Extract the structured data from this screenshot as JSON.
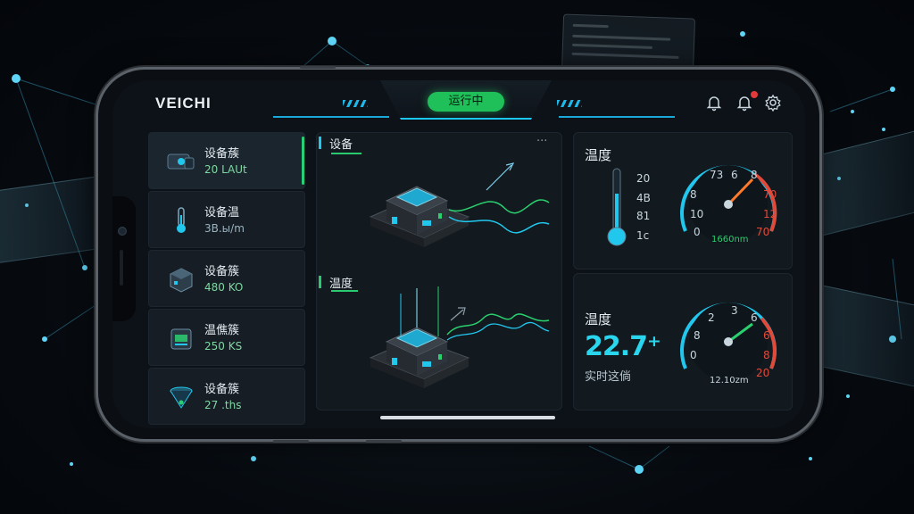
{
  "app": {
    "brand": "VEICHI",
    "status": "运行中"
  },
  "header": {
    "icons": [
      "bell-icon",
      "bell-alert-icon",
      "settings-icon"
    ]
  },
  "sidebar": {
    "items": [
      {
        "title": "设备蔟",
        "sub": "20 LAUt",
        "icon": "truck-device-icon"
      },
      {
        "title": "设备温",
        "sub": "3B.ы/m",
        "icon": "thermometer-icon"
      },
      {
        "title": "设备簇",
        "sub": "480 KO",
        "icon": "cube-device-icon"
      },
      {
        "title": "温僬簇",
        "sub": "250 KS",
        "icon": "server-device-icon"
      },
      {
        "title": "设备簇",
        "sub": "27 .ths",
        "icon": "funnel-device-icon"
      }
    ]
  },
  "middle": {
    "section1": {
      "label": "设备",
      "more": "···"
    },
    "section2": {
      "label": "温度"
    }
  },
  "right": {
    "panel1": {
      "title": "温度",
      "thermo_labels": [
        "20",
        "4B",
        "81",
        "1c"
      ],
      "gauge_ticks": [
        "73",
        "6",
        "8",
        "8",
        "10",
        "70",
        "12",
        "0",
        "70"
      ],
      "gauge_unit": "1660nm"
    },
    "panel2": {
      "title": "温度",
      "value": "22.7⁺",
      "caption": "实时这倘",
      "gauge_ticks": [
        "2",
        "3",
        "6",
        "8",
        "0",
        "6",
        "8",
        "20"
      ],
      "gauge_unit": "12.10zm"
    }
  },
  "colors": {
    "accent": "#19c9ff",
    "status": "#1fbf5a",
    "alert": "#e23a3a"
  }
}
